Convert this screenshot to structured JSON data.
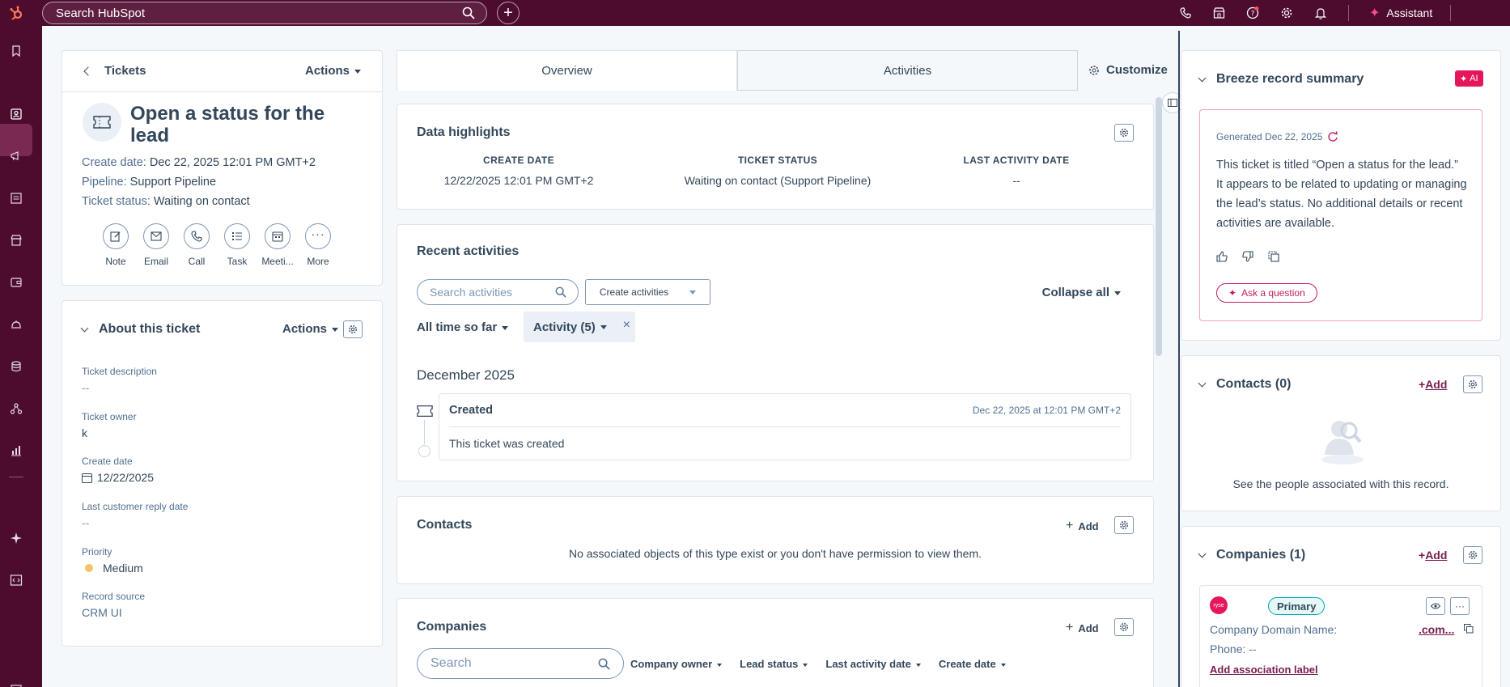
{
  "topbar": {
    "search_placeholder": "Search HubSpot",
    "assistant_label": "Assistant",
    "colors": {
      "bg": "#4d0b2e",
      "accent": "#ff4c8b"
    }
  },
  "left_panel": {
    "back_label": "Tickets",
    "actions_label": "Actions",
    "title": "Open a status for the lead",
    "create_date_label": "Create date:",
    "create_date_value": "Dec 22, 2025 12:01 PM GMT+2",
    "pipeline_label": "Pipeline:",
    "pipeline_value": "Support Pipeline",
    "status_label": "Ticket status:",
    "status_value": "Waiting on contact",
    "quick_actions": [
      "Note",
      "Email",
      "Call",
      "Task",
      "Meeti...",
      "More"
    ]
  },
  "about": {
    "title": "About this ticket",
    "actions_label": "Actions",
    "fields": [
      {
        "label": "Ticket description",
        "value": "--"
      },
      {
        "label": "Ticket owner",
        "value": "k"
      },
      {
        "label": "Create date",
        "value": "12/22/2025"
      },
      {
        "label": "Last customer reply date",
        "value": "--"
      },
      {
        "label": "Priority",
        "value": "Medium"
      },
      {
        "label": "Record source",
        "value": "CRM UI"
      }
    ],
    "priority_color": "#f5c26b"
  },
  "tabs": {
    "overview": "Overview",
    "activities": "Activities",
    "customize": "Customize"
  },
  "highlights": {
    "title": "Data highlights",
    "cols": [
      {
        "head": "CREATE DATE",
        "value": "12/22/2025 12:01 PM GMT+2"
      },
      {
        "head": "TICKET STATUS",
        "value": "Waiting on contact (Support Pipeline)"
      },
      {
        "head": "LAST ACTIVITY DATE",
        "value": "--"
      }
    ]
  },
  "recent": {
    "title": "Recent activities",
    "search_placeholder": "Search activities",
    "create_label": "Create activities",
    "collapse_label": "Collapse all",
    "time_filter": "All time so far",
    "activity_filter": "Activity (5)",
    "month": "December 2025",
    "item": {
      "title": "Created",
      "timestamp": "Dec 22, 2025 at 12:01 PM GMT+2",
      "body": "This ticket was created"
    }
  },
  "contacts_mid": {
    "title": "Contacts",
    "add_label": "Add",
    "empty": "No associated objects of this type exist or you don't have permission to view them."
  },
  "companies_mid": {
    "title": "Companies",
    "add_label": "Add",
    "search_placeholder": "Search",
    "filters": [
      "Company owner",
      "Lead status",
      "Last activity date",
      "Create date"
    ]
  },
  "right": {
    "breeze_title": "Breeze record summary",
    "ai_badge": "AI",
    "generated": "Generated Dec 22, 2025",
    "summary": "This ticket is titled “Open a status for the lead.” It appears to be related to updating or managing the lead’s status. No additional details or recent activities are available.",
    "ask_label": "Ask a question",
    "contacts_title": "Contacts (0)",
    "contacts_add": "Add",
    "contacts_empty": "See the people associated with this record.",
    "companies_title": "Companies (1)",
    "companies_add": "Add",
    "company_badge": "Primary",
    "company_logo_text": "ryse",
    "domain_label": "Company Domain Name:",
    "domain_value": ".com...",
    "phone_label": "Phone: --",
    "assoc_label": "Add association label"
  }
}
